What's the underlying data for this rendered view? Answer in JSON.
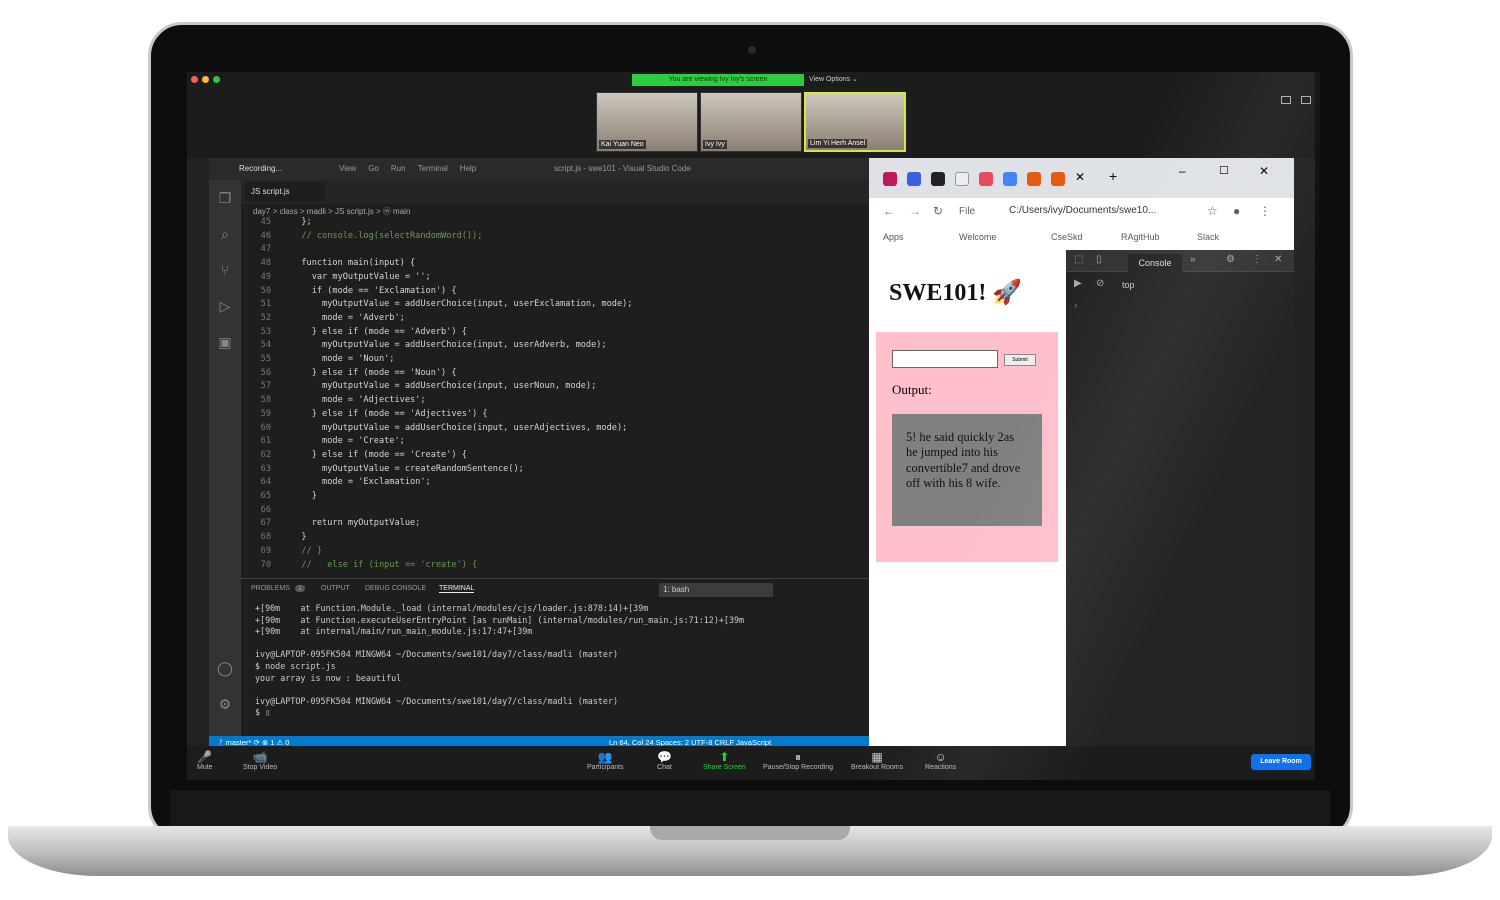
{
  "zoom": {
    "viewing_banner": "You are viewing Ivy Ivy's screen",
    "view_options": "View Options ⌄",
    "participants": [
      "Kai Yuan Neo",
      "Ivy Ivy",
      "Lim Yi Herh Ansel"
    ],
    "toolbar": [
      {
        "label": "Mute",
        "icon": "🎤"
      },
      {
        "label": "Stop Video",
        "icon": "📹"
      },
      {
        "label": "Participants",
        "icon": "👥",
        "count": "3"
      },
      {
        "label": "Chat",
        "icon": "💬"
      },
      {
        "label": "Share Screen",
        "icon": "⬆"
      },
      {
        "label": "Pause/Stop Recording",
        "icon": "⏸"
      },
      {
        "label": "Breakout Rooms",
        "icon": "▦"
      },
      {
        "label": "Reactions",
        "icon": "☺"
      }
    ],
    "leave_label": "Leave Room"
  },
  "vscode": {
    "recording": "Recording...",
    "menu": [
      "View",
      "Go",
      "Run",
      "Terminal",
      "Help"
    ],
    "title": "script.js - swe101 - Visual Studio Code",
    "tab": "JS  script.js",
    "breadcrumb": "day7 > class > madli > JS script.js > ⓜ main",
    "code": [
      {
        "n": "45",
        "t": "  };"
      },
      {
        "n": "46",
        "t": "  // console.log(selectRandomWord());"
      },
      {
        "n": "47",
        "t": ""
      },
      {
        "n": "48",
        "t": "  function main(input) {"
      },
      {
        "n": "49",
        "t": "    var myOutputValue = '';"
      },
      {
        "n": "50",
        "t": "    if (mode == 'Exclamation') {"
      },
      {
        "n": "51",
        "t": "      myOutputValue = addUserChoice(input, userExclamation, mode);"
      },
      {
        "n": "52",
        "t": "      mode = 'Adverb';"
      },
      {
        "n": "53",
        "t": "    } else if (mode == 'Adverb') {"
      },
      {
        "n": "54",
        "t": "      myOutputValue = addUserChoice(input, userAdverb, mode);"
      },
      {
        "n": "55",
        "t": "      mode = 'Noun';"
      },
      {
        "n": "56",
        "t": "    } else if (mode == 'Noun') {"
      },
      {
        "n": "57",
        "t": "      myOutputValue = addUserChoice(input, userNoun, mode);"
      },
      {
        "n": "58",
        "t": "      mode = 'Adjectives';"
      },
      {
        "n": "59",
        "t": "    } else if (mode == 'Adjectives') {"
      },
      {
        "n": "60",
        "t": "      myOutputValue = addUserChoice(input, userAdjectives, mode);"
      },
      {
        "n": "61",
        "t": "      mode = 'Create';"
      },
      {
        "n": "62",
        "t": "    } else if (mode == 'Create') {"
      },
      {
        "n": "63",
        "t": "      myOutputValue = createRandomSentence();"
      },
      {
        "n": "64",
        "t": "      mode = 'Exclamation';"
      },
      {
        "n": "65",
        "t": "    }"
      },
      {
        "n": "66",
        "t": ""
      },
      {
        "n": "67",
        "t": "    return myOutputValue;"
      },
      {
        "n": "68",
        "t": "  }"
      },
      {
        "n": "69",
        "t": "  // }"
      },
      {
        "n": "70",
        "t": "  //   else if (input == 'create') {"
      }
    ],
    "panel_tabs": [
      "PROBLEMS",
      "OUTPUT",
      "DEBUG CONSOLE",
      "TERMINAL"
    ],
    "problems_count": "1",
    "shell": "1: bash",
    "terminal": "+[90m    at Function.Module._load (internal/modules/cjs/loader.js:878:14)+[39m\n+[90m    at Function.executeUserEntryPoint [as runMain] (internal/modules/run_main.js:71:12)+[39m\n+[90m    at internal/main/run_main_module.js:17:47+[39m\n\nivy@LAPTOP-095FK504 MINGW64 ~/Documents/swe101/day7/class/madli (master)\n$ node script.js\nyour array is now : beautiful\n\nivy@LAPTOP-095FK504 MINGW64 ~/Documents/swe101/day7/class/madli (master)\n$ ▯",
    "status_left": "ᚠ master*   ⟳   ⊗ 1 ⚠ 0",
    "status_right": "Ln 64, Col 24    Spaces: 2    UTF-8    CRLF    JavaScript"
  },
  "chrome": {
    "address_prefix": "File",
    "address": "C:/Users/ivy/Documents/swe10...",
    "bookmarks": [
      "Apps",
      "Welcome",
      "CseSkd",
      "RAgitHub",
      "Slack"
    ],
    "page_title": "SWE101! 🚀",
    "submit_label": "Submit",
    "output_label": "Output:",
    "output_text": "5! he said quickly 2as he jumped into his convertible7 and drove off with his 8 wife.",
    "devtools_tab": "Console",
    "devtools_context": "top"
  }
}
